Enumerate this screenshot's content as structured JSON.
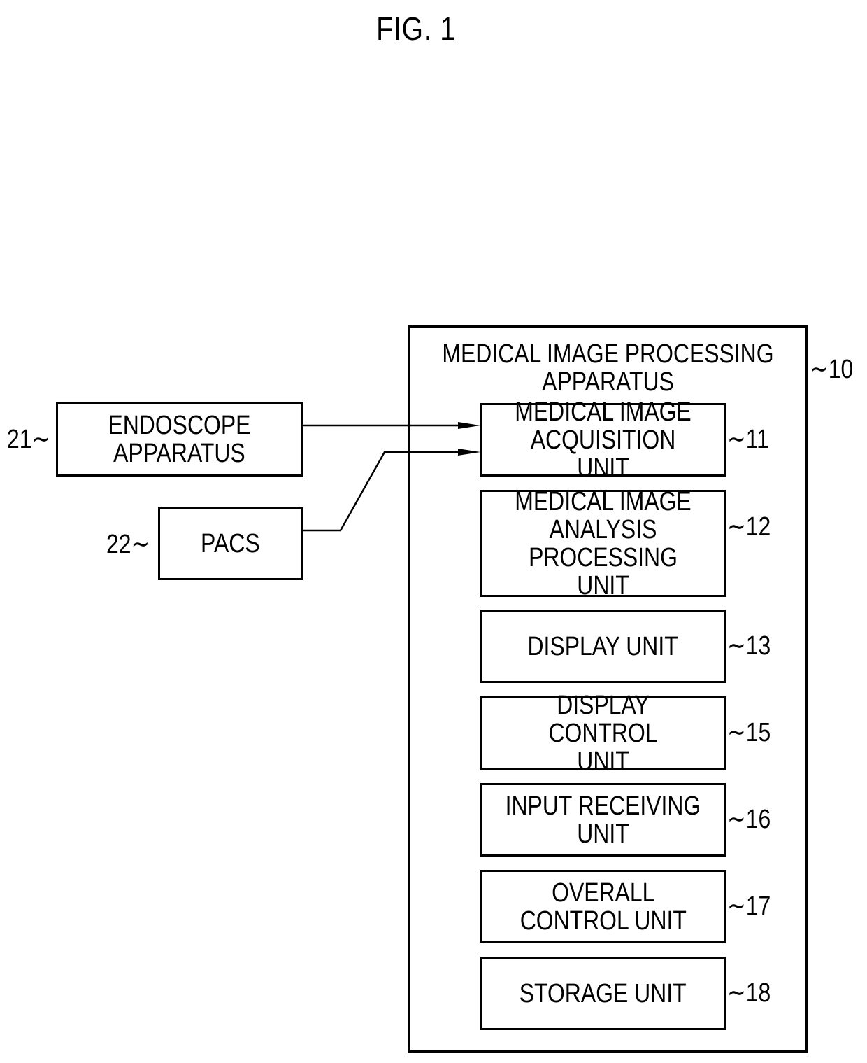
{
  "figure_title": "FIG. 1",
  "external": [
    {
      "id": "21",
      "label": "ENDOSCOPE\nAPPARATUS"
    },
    {
      "id": "22",
      "label": "PACS"
    }
  ],
  "apparatus": {
    "id": "10",
    "label": "MEDICAL IMAGE PROCESSING\nAPPARATUS",
    "units": [
      {
        "id": "11",
        "label": "MEDICAL IMAGE\nACQUISITION UNIT"
      },
      {
        "id": "12",
        "label": "MEDICAL IMAGE\nANALYSIS\nPROCESSING UNIT"
      },
      {
        "id": "13",
        "label": "DISPLAY UNIT"
      },
      {
        "id": "15",
        "label": "DISPLAY CONTROL\nUNIT"
      },
      {
        "id": "16",
        "label": "INPUT RECEIVING\nUNIT"
      },
      {
        "id": "17",
        "label": "OVERALL\nCONTROL UNIT"
      },
      {
        "id": "18",
        "label": "STORAGE UNIT"
      }
    ]
  },
  "connections": [
    {
      "from": "21",
      "to": "11"
    },
    {
      "from": "22",
      "to": "11"
    }
  ],
  "ref_prefix": "~"
}
